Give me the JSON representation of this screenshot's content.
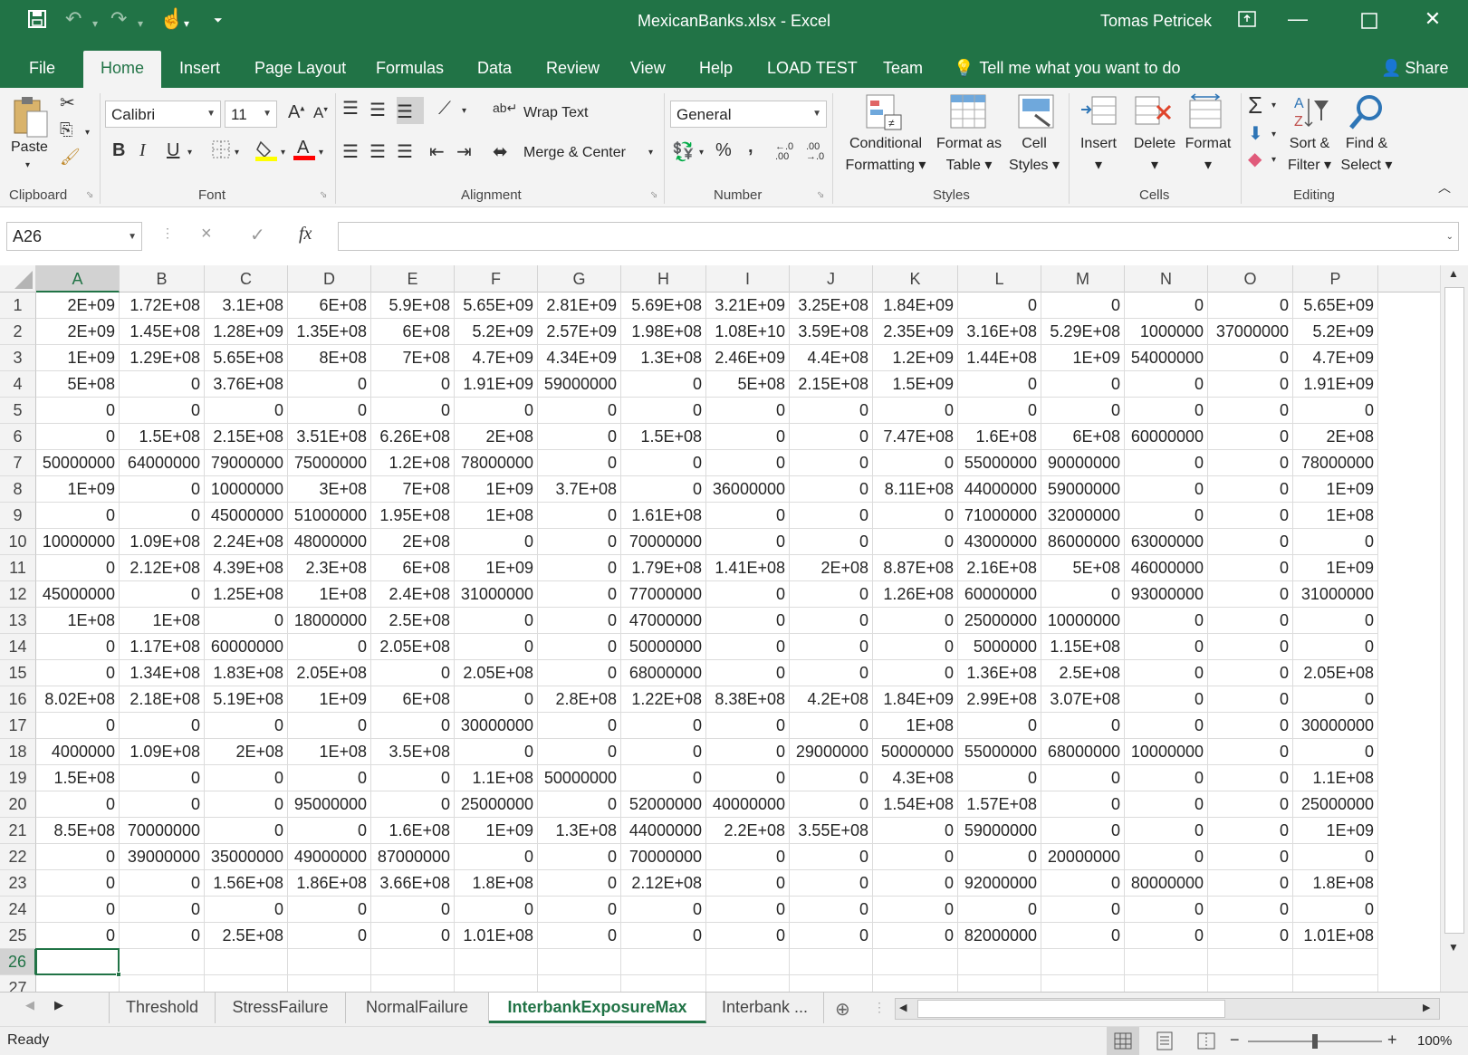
{
  "titlebar": {
    "filename": "MexicanBanks.xlsx",
    "app": "Excel",
    "separator": " - ",
    "user": "Tomas Petricek",
    "icons": {
      "save": "save-icon",
      "undo": "undo-icon",
      "redo": "redo-icon",
      "touch": "touch-mode-icon",
      "customize": "customize-qat-icon",
      "ribbon_options": "ribbon-display-options-icon",
      "minimize": "minimize-icon",
      "maximize": "maximize-icon",
      "close": "close-icon"
    }
  },
  "ribbon_tabs": [
    {
      "label": "File",
      "key": "file"
    },
    {
      "label": "Home",
      "key": "home",
      "active": true
    },
    {
      "label": "Insert",
      "key": "insert"
    },
    {
      "label": "Page Layout",
      "key": "page-layout"
    },
    {
      "label": "Formulas",
      "key": "formulas"
    },
    {
      "label": "Data",
      "key": "data"
    },
    {
      "label": "Review",
      "key": "review"
    },
    {
      "label": "View",
      "key": "view"
    },
    {
      "label": "Help",
      "key": "help"
    },
    {
      "label": "LOAD TEST",
      "key": "load-test"
    },
    {
      "label": "Team",
      "key": "team"
    }
  ],
  "tell_me": "Tell me what you want to do",
  "share": "Share",
  "ribbon": {
    "groups": {
      "clipboard": "Clipboard",
      "font": "Font",
      "alignment": "Alignment",
      "number": "Number",
      "styles": "Styles",
      "cells": "Cells",
      "editing": "Editing"
    },
    "paste": "Paste",
    "font_name": "Calibri",
    "font_size": "11",
    "wrap_text": "Wrap Text",
    "merge_center": "Merge & Center",
    "number_format": "General",
    "percent": "%",
    "comma": ",",
    "conditional": [
      "Conditional",
      "Formatting"
    ],
    "format_table": [
      "Format as",
      "Table"
    ],
    "cell_styles": [
      "Cell",
      "Styles"
    ],
    "insert": "Insert",
    "delete": "Delete",
    "format": "Format",
    "sort_filter": [
      "Sort &",
      "Filter"
    ],
    "find_select": [
      "Find &",
      "Select"
    ],
    "bold": "B",
    "italic": "I",
    "underline": "U"
  },
  "formula_bar": {
    "name_box": "A26",
    "formula": "",
    "cancel_icon": "×",
    "enter_icon": "✓",
    "fx": "fx"
  },
  "columns": [
    "A",
    "B",
    "C",
    "D",
    "E",
    "F",
    "G",
    "H",
    "I",
    "J",
    "K",
    "L",
    "M",
    "N",
    "O",
    "P"
  ],
  "selected_cell": {
    "col": "A",
    "row": 26
  },
  "rows": [
    {
      "n": "1",
      "cells": [
        "2E+09",
        "1.72E+08",
        "3.1E+08",
        "6E+08",
        "5.9E+08",
        "5.65E+09",
        "2.81E+09",
        "5.69E+08",
        "3.21E+09",
        "3.25E+08",
        "1.84E+09",
        "0",
        "0",
        "0",
        "0",
        "5.65E+09"
      ]
    },
    {
      "n": "2",
      "cells": [
        "2E+09",
        "1.45E+08",
        "1.28E+09",
        "1.35E+08",
        "6E+08",
        "5.2E+09",
        "2.57E+09",
        "1.98E+08",
        "1.08E+10",
        "3.59E+08",
        "2.35E+09",
        "3.16E+08",
        "5.29E+08",
        "1000000",
        "37000000",
        "5.2E+09"
      ]
    },
    {
      "n": "3",
      "cells": [
        "1E+09",
        "1.29E+08",
        "5.65E+08",
        "8E+08",
        "7E+08",
        "4.7E+09",
        "4.34E+09",
        "1.3E+08",
        "2.46E+09",
        "4.4E+08",
        "1.2E+09",
        "1.44E+08",
        "1E+09",
        "54000000",
        "0",
        "4.7E+09"
      ]
    },
    {
      "n": "4",
      "cells": [
        "5E+08",
        "0",
        "3.76E+08",
        "0",
        "0",
        "1.91E+09",
        "59000000",
        "0",
        "5E+08",
        "2.15E+08",
        "1.5E+09",
        "0",
        "0",
        "0",
        "0",
        "1.91E+09"
      ]
    },
    {
      "n": "5",
      "cells": [
        "0",
        "0",
        "0",
        "0",
        "0",
        "0",
        "0",
        "0",
        "0",
        "0",
        "0",
        "0",
        "0",
        "0",
        "0",
        "0"
      ]
    },
    {
      "n": "6",
      "cells": [
        "0",
        "1.5E+08",
        "2.15E+08",
        "3.51E+08",
        "6.26E+08",
        "2E+08",
        "0",
        "1.5E+08",
        "0",
        "0",
        "7.47E+08",
        "1.6E+08",
        "6E+08",
        "60000000",
        "0",
        "2E+08"
      ]
    },
    {
      "n": "7",
      "cells": [
        "50000000",
        "64000000",
        "79000000",
        "75000000",
        "1.2E+08",
        "78000000",
        "0",
        "0",
        "0",
        "0",
        "0",
        "55000000",
        "90000000",
        "0",
        "0",
        "78000000"
      ]
    },
    {
      "n": "8",
      "cells": [
        "1E+09",
        "0",
        "10000000",
        "3E+08",
        "7E+08",
        "1E+09",
        "3.7E+08",
        "0",
        "36000000",
        "0",
        "8.11E+08",
        "44000000",
        "59000000",
        "0",
        "0",
        "1E+09"
      ]
    },
    {
      "n": "9",
      "cells": [
        "0",
        "0",
        "45000000",
        "51000000",
        "1.95E+08",
        "1E+08",
        "0",
        "1.61E+08",
        "0",
        "0",
        "0",
        "71000000",
        "32000000",
        "0",
        "0",
        "1E+08"
      ]
    },
    {
      "n": "10",
      "cells": [
        "10000000",
        "1.09E+08",
        "2.24E+08",
        "48000000",
        "2E+08",
        "0",
        "0",
        "70000000",
        "0",
        "0",
        "0",
        "43000000",
        "86000000",
        "63000000",
        "0",
        "0"
      ]
    },
    {
      "n": "11",
      "cells": [
        "0",
        "2.12E+08",
        "4.39E+08",
        "2.3E+08",
        "6E+08",
        "1E+09",
        "0",
        "1.79E+08",
        "1.41E+08",
        "2E+08",
        "8.87E+08",
        "2.16E+08",
        "5E+08",
        "46000000",
        "0",
        "1E+09"
      ]
    },
    {
      "n": "12",
      "cells": [
        "45000000",
        "0",
        "1.25E+08",
        "1E+08",
        "2.4E+08",
        "31000000",
        "0",
        "77000000",
        "0",
        "0",
        "1.26E+08",
        "60000000",
        "0",
        "93000000",
        "0",
        "31000000"
      ]
    },
    {
      "n": "13",
      "cells": [
        "1E+08",
        "1E+08",
        "0",
        "18000000",
        "2.5E+08",
        "0",
        "0",
        "47000000",
        "0",
        "0",
        "0",
        "25000000",
        "10000000",
        "0",
        "0",
        "0"
      ]
    },
    {
      "n": "14",
      "cells": [
        "0",
        "1.17E+08",
        "60000000",
        "0",
        "2.05E+08",
        "0",
        "0",
        "50000000",
        "0",
        "0",
        "0",
        "5000000",
        "1.15E+08",
        "0",
        "0",
        "0"
      ]
    },
    {
      "n": "15",
      "cells": [
        "0",
        "1.34E+08",
        "1.83E+08",
        "2.05E+08",
        "0",
        "2.05E+08",
        "0",
        "68000000",
        "0",
        "0",
        "0",
        "1.36E+08",
        "2.5E+08",
        "0",
        "0",
        "2.05E+08"
      ]
    },
    {
      "n": "16",
      "cells": [
        "8.02E+08",
        "2.18E+08",
        "5.19E+08",
        "1E+09",
        "6E+08",
        "0",
        "2.8E+08",
        "1.22E+08",
        "8.38E+08",
        "4.2E+08",
        "1.84E+09",
        "2.99E+08",
        "3.07E+08",
        "0",
        "0",
        "0"
      ]
    },
    {
      "n": "17",
      "cells": [
        "0",
        "0",
        "0",
        "0",
        "0",
        "30000000",
        "0",
        "0",
        "0",
        "0",
        "1E+08",
        "0",
        "0",
        "0",
        "0",
        "30000000"
      ]
    },
    {
      "n": "18",
      "cells": [
        "4000000",
        "1.09E+08",
        "2E+08",
        "1E+08",
        "3.5E+08",
        "0",
        "0",
        "0",
        "0",
        "29000000",
        "50000000",
        "55000000",
        "68000000",
        "10000000",
        "0",
        "0"
      ]
    },
    {
      "n": "19",
      "cells": [
        "1.5E+08",
        "0",
        "0",
        "0",
        "0",
        "1.1E+08",
        "50000000",
        "0",
        "0",
        "0",
        "4.3E+08",
        "0",
        "0",
        "0",
        "0",
        "1.1E+08"
      ]
    },
    {
      "n": "20",
      "cells": [
        "0",
        "0",
        "0",
        "95000000",
        "0",
        "25000000",
        "0",
        "52000000",
        "40000000",
        "0",
        "1.54E+08",
        "1.57E+08",
        "0",
        "0",
        "0",
        "25000000"
      ]
    },
    {
      "n": "21",
      "cells": [
        "8.5E+08",
        "70000000",
        "0",
        "0",
        "1.6E+08",
        "1E+09",
        "1.3E+08",
        "44000000",
        "2.2E+08",
        "3.55E+08",
        "0",
        "59000000",
        "0",
        "0",
        "0",
        "1E+09"
      ]
    },
    {
      "n": "22",
      "cells": [
        "0",
        "39000000",
        "35000000",
        "49000000",
        "87000000",
        "0",
        "0",
        "70000000",
        "0",
        "0",
        "0",
        "0",
        "20000000",
        "0",
        "0",
        "0"
      ]
    },
    {
      "n": "23",
      "cells": [
        "0",
        "0",
        "1.56E+08",
        "1.86E+08",
        "3.66E+08",
        "1.8E+08",
        "0",
        "2.12E+08",
        "0",
        "0",
        "0",
        "92000000",
        "0",
        "80000000",
        "0",
        "1.8E+08"
      ]
    },
    {
      "n": "24",
      "cells": [
        "0",
        "0",
        "0",
        "0",
        "0",
        "0",
        "0",
        "0",
        "0",
        "0",
        "0",
        "0",
        "0",
        "0",
        "0",
        "0"
      ]
    },
    {
      "n": "25",
      "cells": [
        "0",
        "0",
        "2.5E+08",
        "0",
        "0",
        "1.01E+08",
        "0",
        "0",
        "0",
        "0",
        "0",
        "82000000",
        "0",
        "0",
        "0",
        "1.01E+08"
      ]
    },
    {
      "n": "26",
      "cells": [
        "",
        "",
        "",
        "",
        "",
        "",
        "",
        "",
        "",
        "",
        "",
        "",
        "",
        "",
        "",
        ""
      ]
    },
    {
      "n": "27",
      "cells": [
        "",
        "",
        "",
        "",
        "",
        "",
        "",
        "",
        "",
        "",
        "",
        "",
        "",
        "",
        "",
        ""
      ]
    }
  ],
  "sheet_tabs": [
    {
      "label": "Threshold"
    },
    {
      "label": "StressFailure"
    },
    {
      "label": "NormalFailure"
    },
    {
      "label": "InterbankExposureMax",
      "active": true
    },
    {
      "label": "Interbank ..."
    }
  ],
  "status": {
    "ready": "Ready",
    "zoom": "100%",
    "zoom_level_percent": 100
  },
  "colors": {
    "accent": "#217346",
    "ribbon_bg": "#f3f3f3",
    "grid_line": "#dcdcdc"
  }
}
